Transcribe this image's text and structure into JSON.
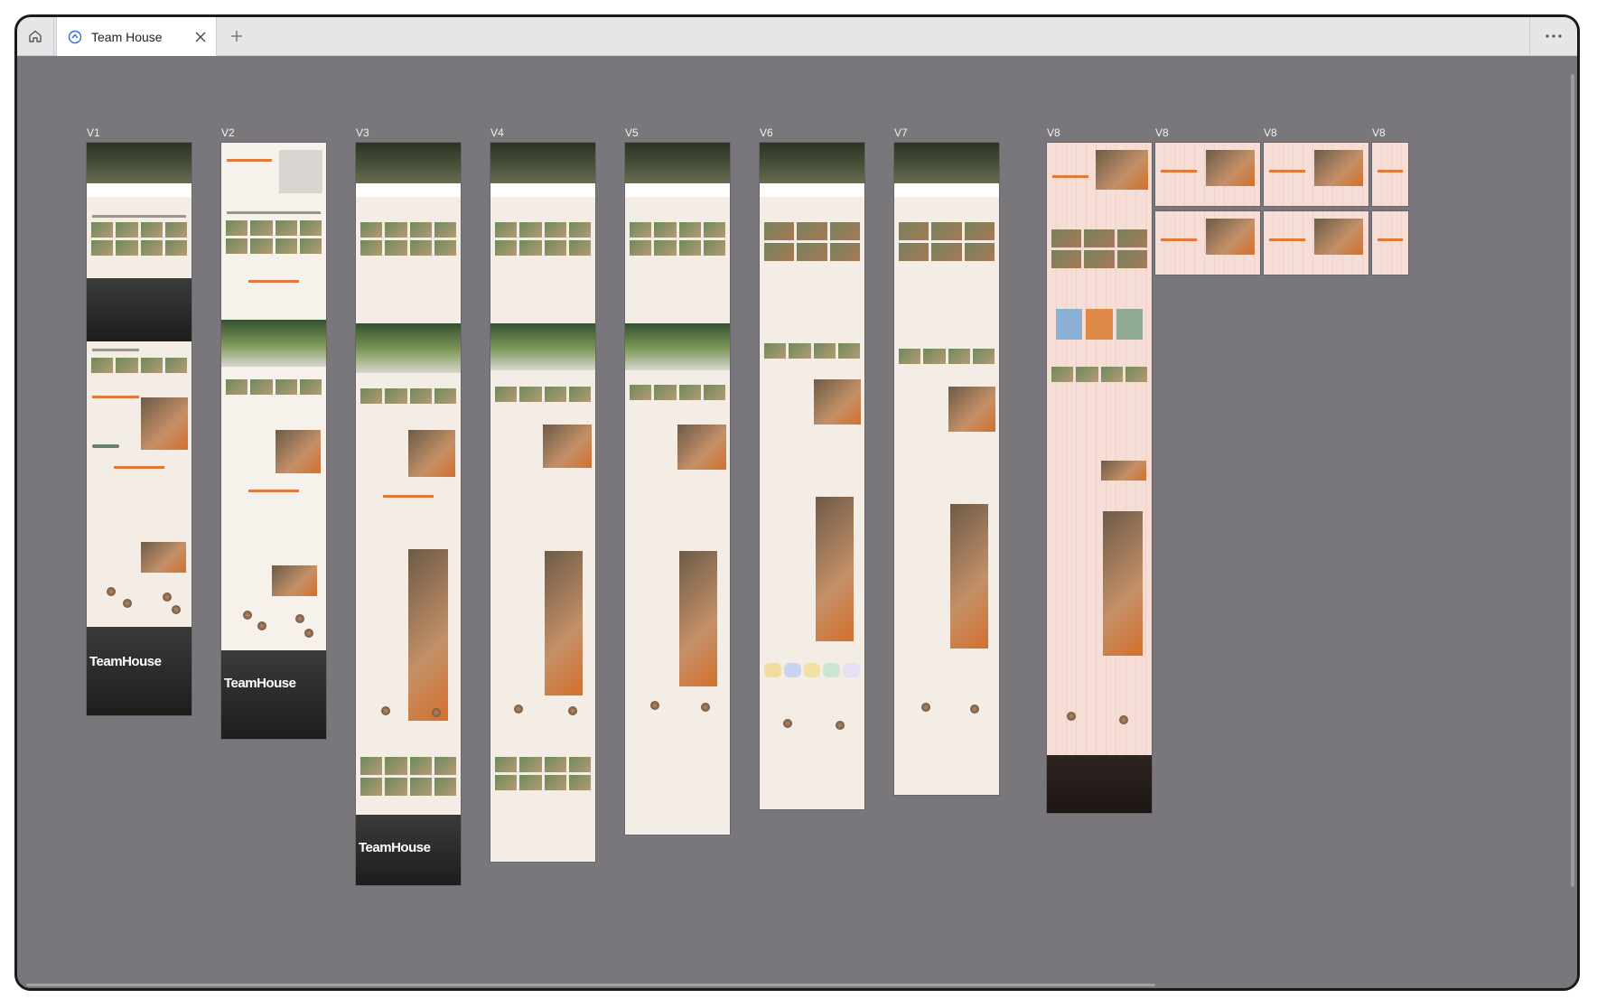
{
  "tabs": [
    {
      "title": "Team House",
      "icon": "teamhouse-logo-icon",
      "active": true
    }
  ],
  "toolbar": {
    "home_icon": "home-icon",
    "new_tab_icon": "plus-icon",
    "more_icon": "more-icon"
  },
  "canvas": {
    "background": "#7a777c",
    "frames": [
      {
        "label": "V1"
      },
      {
        "label": "V2"
      },
      {
        "label": "V3"
      },
      {
        "label": "V4"
      },
      {
        "label": "V5"
      },
      {
        "label": "V6"
      },
      {
        "label": "V7"
      },
      {
        "label": "V8"
      },
      {
        "label": "V8"
      },
      {
        "label": "V8"
      },
      {
        "label": "V8"
      }
    ],
    "brand_wordmark": "TeamHouse"
  },
  "colors": {
    "accent": "#e07a3a",
    "button_green": "#6b7f6a",
    "page_cream": "#f3ede6",
    "v8_pink": "#f6ddd6"
  }
}
